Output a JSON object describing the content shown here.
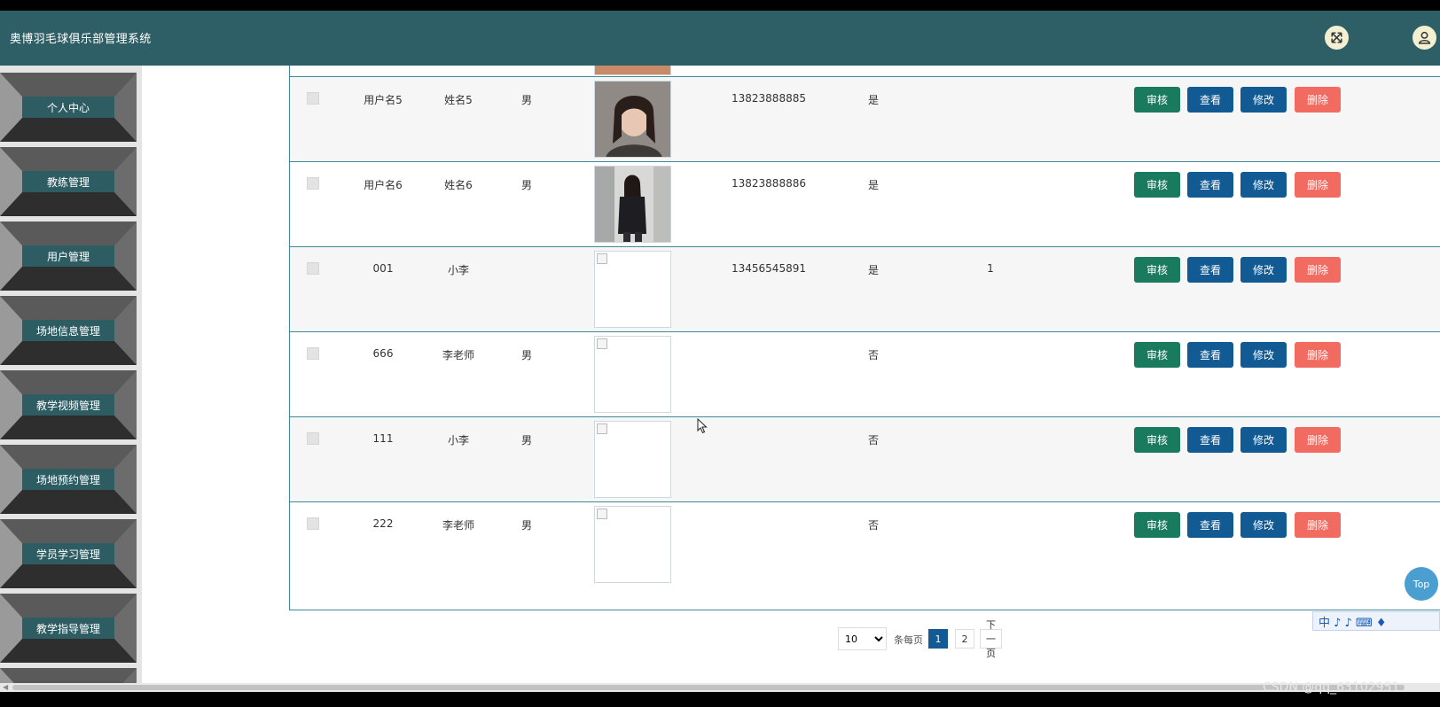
{
  "app": {
    "title": "奥博羽毛球俱乐部管理系统"
  },
  "header_icons": [
    "fullscreen-exit-icon",
    "user-icon"
  ],
  "sidebar": {
    "items": [
      {
        "label": "个人中心"
      },
      {
        "label": "教练管理"
      },
      {
        "label": "用户管理"
      },
      {
        "label": "场地信息管理"
      },
      {
        "label": "教学视频管理"
      },
      {
        "label": "场地预约管理"
      },
      {
        "label": "学员学习管理"
      },
      {
        "label": "教学指导管理"
      }
    ]
  },
  "table": {
    "rows": [
      {
        "account": "用户名5",
        "name": "姓名5",
        "gender": "男",
        "photo": "photo-woman-portrait",
        "phone": "13823888885",
        "audited": "是",
        "extra": ""
      },
      {
        "account": "用户名6",
        "name": "姓名6",
        "gender": "男",
        "photo": "photo-woman-street",
        "phone": "13823888886",
        "audited": "是",
        "extra": ""
      },
      {
        "account": "001",
        "name": "小李",
        "gender": "",
        "photo": "broken-image",
        "phone": "13456545891",
        "audited": "是",
        "extra": "1"
      },
      {
        "account": "666",
        "name": "李老师",
        "gender": "男",
        "photo": "broken-image",
        "phone": "",
        "audited": "否",
        "extra": ""
      },
      {
        "account": "111",
        "name": "小李",
        "gender": "男",
        "photo": "broken-image",
        "phone": "",
        "audited": "否",
        "extra": ""
      },
      {
        "account": "222",
        "name": "李老师",
        "gender": "男",
        "photo": "broken-image",
        "phone": "",
        "audited": "否",
        "extra": ""
      }
    ],
    "actions": {
      "audit": "审核",
      "view": "查看",
      "edit": "修改",
      "delete": "删除"
    }
  },
  "pagination": {
    "page_size": "10",
    "per_page_label": "条每页",
    "pages": [
      "1",
      "2"
    ],
    "current_page": "1",
    "next_label": "下一页"
  },
  "back_to_top": "Top",
  "ime_bar": "中 ♪ ♪ ⌨ ♦",
  "watermark": "CSDN @qq_63102951",
  "colors": {
    "header": "#2f5f66",
    "sidebar_label": "#2d5c63",
    "audit_button": "#1a7a5e",
    "primary_button": "#115a94",
    "delete_button": "#f26b61",
    "table_border": "#3f8a94"
  }
}
